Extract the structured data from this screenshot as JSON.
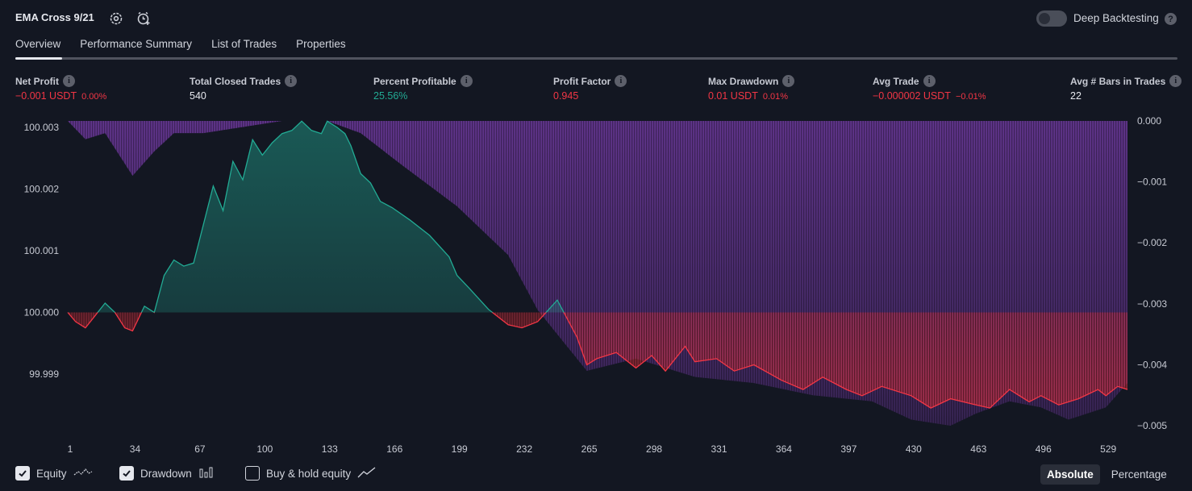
{
  "header": {
    "title": "EMA Cross 9/21",
    "icons": [
      "settings-gear-icon",
      "alarm-add-icon"
    ],
    "deep_backtesting_label": "Deep Backtesting",
    "deep_backtesting_enabled": false,
    "help_glyph": "?"
  },
  "tabs": [
    {
      "label": "Overview",
      "active": true
    },
    {
      "label": "Performance Summary",
      "active": false
    },
    {
      "label": "List of Trades",
      "active": false
    },
    {
      "label": "Properties",
      "active": false
    }
  ],
  "metrics": [
    {
      "label": "Net Profit",
      "value": "−0.001 USDT",
      "pct": "0.00%",
      "color": "#f23645"
    },
    {
      "label": "Total Closed Trades",
      "value": "540",
      "pct": "",
      "color": "#e6e8ee"
    },
    {
      "label": "Percent Profitable",
      "value": "25.56%",
      "pct": "",
      "color": "#22ab94"
    },
    {
      "label": "Profit Factor",
      "value": "0.945",
      "pct": "",
      "color": "#f23645"
    },
    {
      "label": "Max Drawdown",
      "value": "0.01 USDT",
      "pct": "0.01%",
      "color": "#f23645"
    },
    {
      "label": "Avg Trade",
      "value": "−0.000002 USDT",
      "pct": "−0.01%",
      "color": "#f23645"
    },
    {
      "label": "Avg # Bars in Trades",
      "value": "22",
      "pct": "",
      "color": "#e6e8ee"
    }
  ],
  "info_glyph": "i",
  "legend": {
    "equity_label": "Equity",
    "equity_checked": true,
    "drawdown_label": "Drawdown",
    "drawdown_checked": true,
    "buyhold_label": "Buy & hold equity",
    "buyhold_checked": false
  },
  "mode": {
    "absolute_label": "Absolute",
    "percentage_label": "Percentage",
    "selected": "Absolute"
  },
  "colors": {
    "background": "#131722",
    "profit": "#22ab94",
    "loss": "#f23645",
    "drawdown": "#7b3fb0"
  },
  "chart_data": {
    "type": "area",
    "left_axis_ticks": [
      "100.003",
      "100.002",
      "100.001",
      "100.000",
      "99.999"
    ],
    "right_axis_ticks": [
      "0.000",
      "−0.001",
      "−0.002",
      "−0.003",
      "−0.004",
      "−0.005"
    ],
    "x_ticks": [
      "1",
      "34",
      "67",
      "100",
      "133",
      "166",
      "199",
      "232",
      "265",
      "298",
      "331",
      "364",
      "397",
      "430",
      "463",
      "496",
      "529"
    ],
    "baseline": 100.0,
    "ylim_left": [
      99.99815,
      100.00305
    ],
    "ylim_right": [
      -0.0053,
      0.0
    ],
    "equity": {
      "x": [
        1,
        5,
        10,
        15,
        20,
        25,
        30,
        34,
        40,
        45,
        50,
        55,
        60,
        65,
        67,
        75,
        80,
        85,
        90,
        95,
        100,
        105,
        110,
        115,
        120,
        125,
        130,
        133,
        138,
        142,
        145,
        150,
        155,
        160,
        166,
        175,
        185,
        195,
        199,
        205,
        215,
        225,
        232,
        240,
        250,
        260,
        265,
        270,
        280,
        290,
        298,
        305,
        315,
        320,
        331,
        340,
        350,
        364,
        375,
        385,
        397,
        405,
        415,
        430,
        440,
        450,
        463,
        470,
        480,
        490,
        496,
        505,
        515,
        525,
        529,
        535,
        540
      ],
      "y": [
        100.0,
        99.99985,
        99.99975,
        99.99995,
        100.00015,
        100.0,
        99.99975,
        99.9997,
        100.0001,
        100.0,
        100.0006,
        100.00085,
        100.00075,
        100.0008,
        100.00105,
        100.00205,
        100.00165,
        100.00245,
        100.00215,
        100.0028,
        100.00255,
        100.00275,
        100.0029,
        100.00295,
        100.0031,
        100.00295,
        100.0029,
        100.0031,
        100.003,
        100.0029,
        100.0027,
        100.00225,
        100.0021,
        100.0018,
        100.0017,
        100.0015,
        100.00125,
        100.0009,
        100.0006,
        100.0004,
        100.00005,
        99.9998,
        99.99975,
        99.99985,
        100.0002,
        99.9996,
        99.99915,
        99.99925,
        99.99935,
        99.9991,
        99.9993,
        99.99905,
        99.99945,
        99.9992,
        99.99925,
        99.99905,
        99.99915,
        99.9989,
        99.99875,
        99.99895,
        99.99875,
        99.99865,
        99.9988,
        99.99865,
        99.99845,
        99.9986,
        99.9985,
        99.99845,
        99.99875,
        99.99855,
        99.99865,
        99.9985,
        99.9986,
        99.99875,
        99.99865,
        99.9988,
        99.99875
      ]
    },
    "drawdown": {
      "x": [
        1,
        10,
        20,
        34,
        45,
        55,
        70,
        90,
        110,
        133,
        150,
        170,
        199,
        225,
        240,
        265,
        290,
        320,
        350,
        380,
        410,
        430,
        450,
        463,
        480,
        496,
        510,
        529,
        540
      ],
      "y": [
        0.0,
        -0.0003,
        -0.0002,
        -0.0009,
        -0.0005,
        -0.0002,
        -0.0002,
        -0.0001,
        0.0,
        0.0,
        -0.0002,
        -0.0007,
        -0.0014,
        -0.0022,
        -0.0031,
        -0.0041,
        -0.0039,
        -0.0042,
        -0.0043,
        -0.0045,
        -0.0046,
        -0.0049,
        -0.005,
        -0.0048,
        -0.0046,
        -0.0047,
        -0.0049,
        -0.0047,
        -0.0043
      ]
    }
  }
}
